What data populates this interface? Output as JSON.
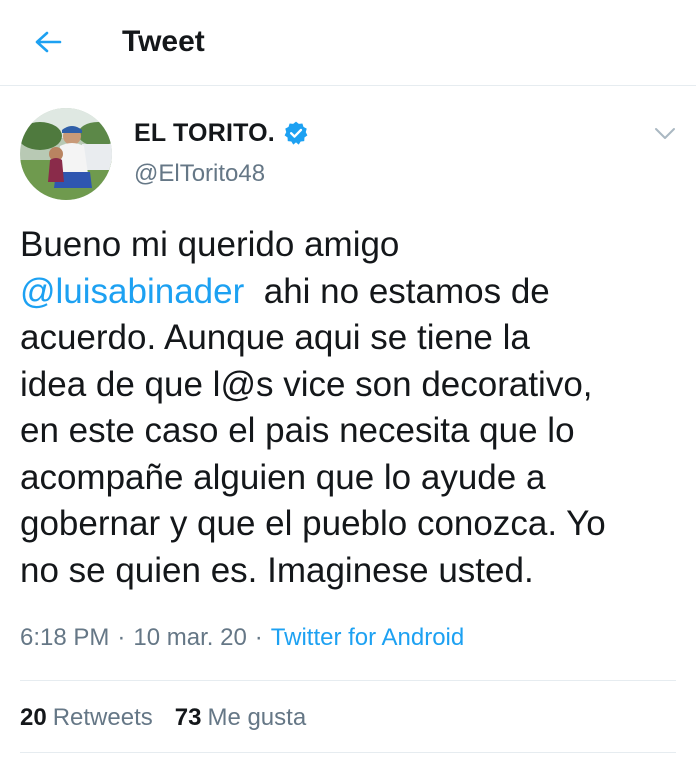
{
  "header": {
    "title": "Tweet",
    "back_icon": "arrow-left-icon"
  },
  "author": {
    "name": "EL TORITO.",
    "handle": "@ElTorito48",
    "verified": true,
    "verified_icon": "verified-badge-icon",
    "menu_icon": "chevron-down-icon"
  },
  "tweet": {
    "line1": "Bueno mi querido amigo",
    "mention": "@luisabinader",
    "line2_rest": "  ahi no estamos de",
    "rest": "acuerdo.  Aunque aqui se tiene la\nidea de que l@s vice son decorativo,\nen este caso el pais necesita que lo\nacompañe alguien que lo ayude a\ngobernar y que el pueblo conozca.  Yo\nno se quien es. Imaginese usted."
  },
  "meta": {
    "time": "6:18 PM",
    "date": "10 mar. 20",
    "separator": "·",
    "source": "Twitter for Android"
  },
  "stats": {
    "retweets_count": "20",
    "retweets_label": "Retweets",
    "likes_count": "73",
    "likes_label": "Me gusta"
  },
  "colors": {
    "accent": "#1da1f2",
    "text": "#14171a",
    "secondary": "#657786",
    "divider": "#e6ecf0"
  }
}
